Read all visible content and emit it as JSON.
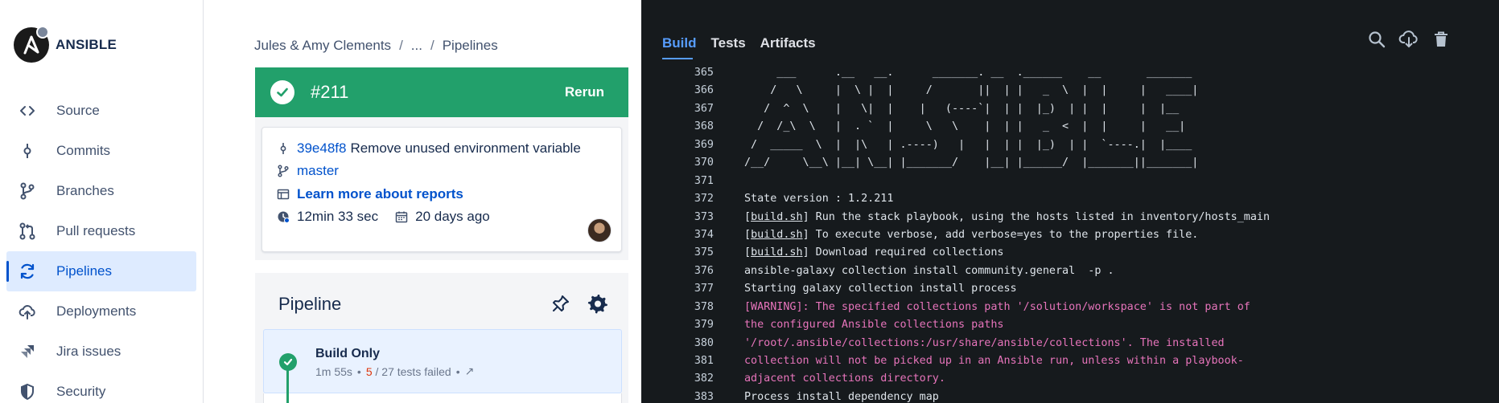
{
  "brand": {
    "name": "ANSIBLE"
  },
  "sidebar": {
    "items": [
      {
        "label": "Source",
        "icon": "code-icon",
        "active": false
      },
      {
        "label": "Commits",
        "icon": "commit-icon",
        "active": false
      },
      {
        "label": "Branches",
        "icon": "branch-icon",
        "active": false
      },
      {
        "label": "Pull requests",
        "icon": "pull-request-icon",
        "active": false
      },
      {
        "label": "Pipelines",
        "icon": "pipelines-icon",
        "active": true
      },
      {
        "label": "Deployments",
        "icon": "cloud-upload-icon",
        "active": false
      },
      {
        "label": "Jira issues",
        "icon": "jira-icon",
        "active": false
      },
      {
        "label": "Security",
        "icon": "shield-icon",
        "active": false
      }
    ]
  },
  "breadcrumb": {
    "workspace": "Jules & Amy Clements",
    "ellipsis": "...",
    "current": "Pipelines",
    "separator": "/"
  },
  "run": {
    "number": "#211",
    "rerun_label": "Rerun",
    "status_color": "#22a06b",
    "commit_hash": "39e48f8",
    "commit_message": "Remove unused environment variable",
    "branch": "master",
    "reports_link": "Learn more about reports",
    "duration": "12min 33 sec",
    "date": "20 days ago"
  },
  "pipeline": {
    "title": "Pipeline",
    "step": {
      "name": "Build Only",
      "duration": "1m 55s",
      "bullet": "•",
      "failed_count": "5",
      "tests_text": "/ 27 tests failed",
      "link_glyph": "↗"
    }
  },
  "log": {
    "tabs": [
      "Build",
      "Tests",
      "Artifacts"
    ],
    "active_tab": "Build",
    "actions": [
      "search-icon",
      "download-icon",
      "delete-icon"
    ],
    "lines": [
      {
        "num": "365",
        "text": "     ___      .__   __.      _______. __  .______    __       _______ ",
        "warn": false
      },
      {
        "num": "366",
        "text": "    /   \\     |  \\ |  |     /       ||  | |   _  \\  |  |     |   ____|",
        "warn": false
      },
      {
        "num": "367",
        "text": "   /  ^  \\    |   \\|  |    |   (----`|  | |  |_)  | |  |     |  |__   ",
        "warn": false
      },
      {
        "num": "368",
        "text": "  /  /_\\  \\   |  . `  |     \\   \\    |  | |   _  <  |  |     |   __|  ",
        "warn": false
      },
      {
        "num": "369",
        "text": " /  _____  \\  |  |\\   | .----)   |   |  | |  |_)  | |  `----.|  |____ ",
        "warn": false
      },
      {
        "num": "370",
        "text": "/__/     \\__\\ |__| \\__| |_______/    |__| |______/  |_______||_______|",
        "warn": false
      },
      {
        "num": "371",
        "text": "",
        "warn": false
      },
      {
        "num": "372",
        "text": "State version : 1.2.211",
        "warn": false
      },
      {
        "num": "373",
        "prefix": "[",
        "link": "build.sh",
        "text": "] Run the stack playbook, using the hosts listed in inventory/hosts_main",
        "warn": false
      },
      {
        "num": "374",
        "prefix": "[",
        "link": "build.sh",
        "text": "] To execute verbose, add verbose=yes to the properties file.",
        "warn": false
      },
      {
        "num": "375",
        "prefix": "[",
        "link": "build.sh",
        "text": "] Download required collections",
        "warn": false
      },
      {
        "num": "376",
        "text": "ansible-galaxy collection install community.general  -p .",
        "warn": false
      },
      {
        "num": "377",
        "text": "Starting galaxy collection install process",
        "warn": false
      },
      {
        "num": "378",
        "text": "[WARNING]: The specified collections path '/solution/workspace' is not part of",
        "warn": true
      },
      {
        "num": "379",
        "text": "the configured Ansible collections paths",
        "warn": true
      },
      {
        "num": "380",
        "text": "'/root/.ansible/collections:/usr/share/ansible/collections'. The installed",
        "warn": true
      },
      {
        "num": "381",
        "text": "collection will not be picked up in an Ansible run, unless within a playbook-",
        "warn": true
      },
      {
        "num": "382",
        "text": "adjacent collections directory.",
        "warn": true
      },
      {
        "num": "383",
        "text": "Process install dependency map",
        "warn": false
      }
    ]
  }
}
